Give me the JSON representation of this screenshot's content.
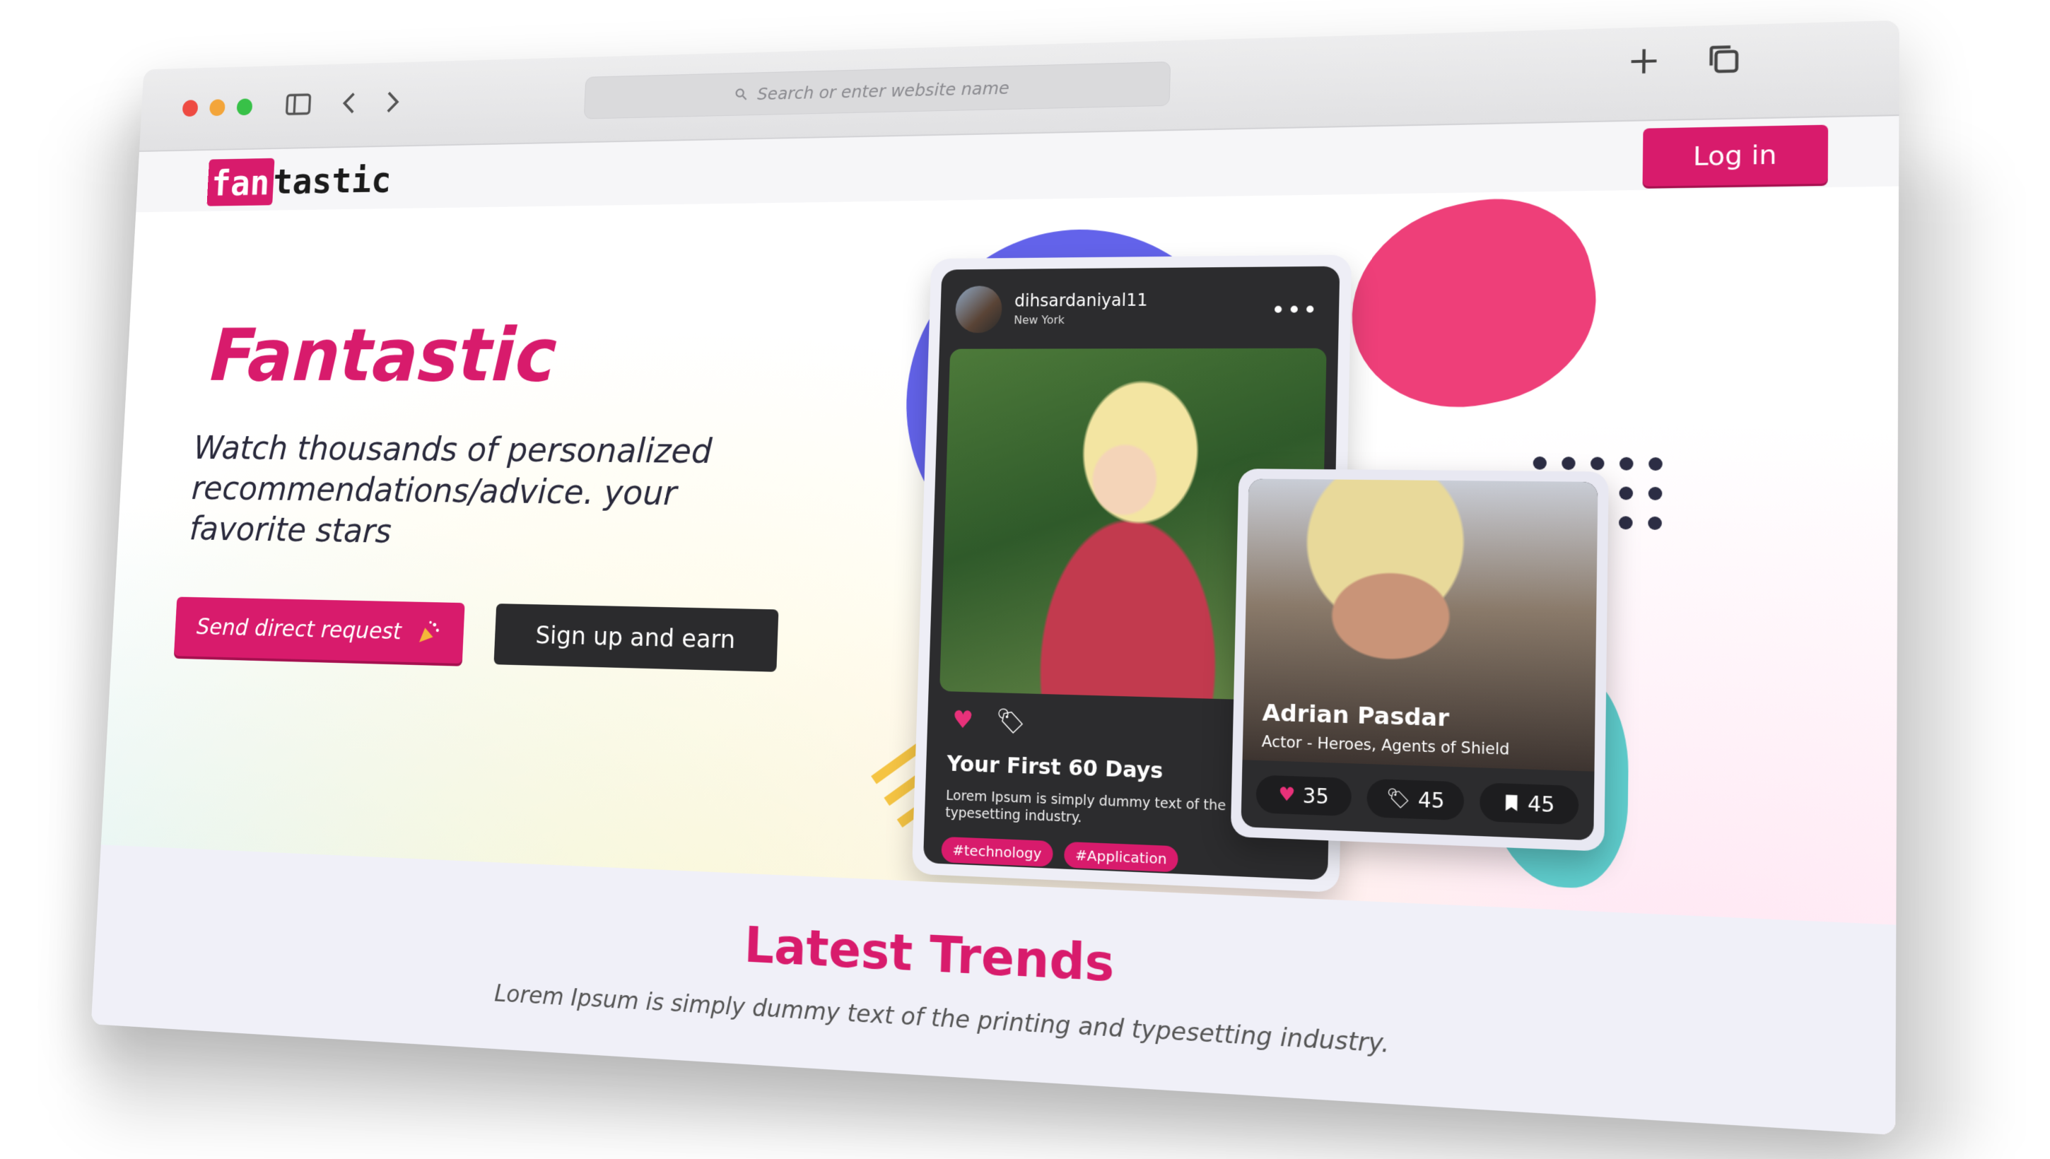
{
  "browser": {
    "search_placeholder": "Search or enter website name"
  },
  "colors": {
    "brand": "#d81b6c",
    "dark_button": "#2b2b2d",
    "blob_blue": "#6363ea",
    "blob_pink": "#ee3f79",
    "blob_teal": "#5fcdcd"
  },
  "nav": {
    "logo_highlight": "fan",
    "logo_rest": "tastic",
    "login_label": "Log in"
  },
  "hero": {
    "title": "Fantastic",
    "subtitle": "Watch thousands of personalized recommendations/advice. your favorite stars",
    "send_request_label": "Send direct request",
    "signup_label": "Sign up and earn"
  },
  "post_card": {
    "username": "dihsardaniyal11",
    "location": "New York",
    "title": "Your First 60 Days",
    "text": "Lorem Ipsum is simply dummy text of the printing and typesetting industry.",
    "hashtags": [
      "#technology",
      "#Application"
    ]
  },
  "actor_card": {
    "name": "Adrian Pasdar",
    "role": "Actor - Heroes, Agents of Shield",
    "likes": "35",
    "tags": "45",
    "saves": "45"
  },
  "trends": {
    "title": "Latest Trends",
    "subtitle": "Lorem Ipsum is simply dummy text of the printing and typesetting industry."
  }
}
